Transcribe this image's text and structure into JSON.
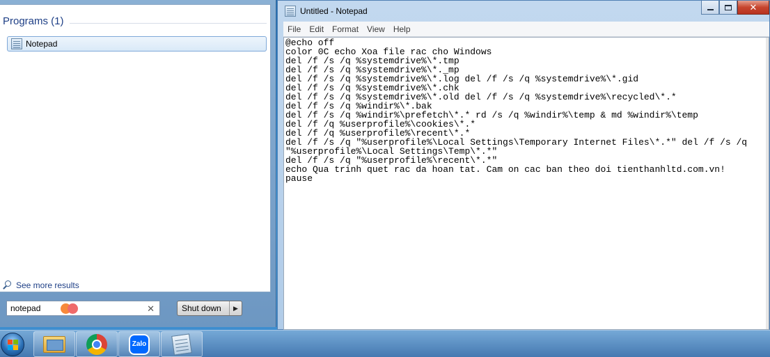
{
  "start_menu": {
    "programs_header": "Programs (1)",
    "programs": [
      {
        "label": "Notepad",
        "icon": "notepad-icon"
      }
    ],
    "see_more": "See more results",
    "search": {
      "value": "notepad"
    },
    "shutdown_label": "Shut down"
  },
  "notepad": {
    "title": "Untitled - Notepad",
    "menu": [
      "File",
      "Edit",
      "Format",
      "View",
      "Help"
    ],
    "content": "@echo off\ncolor 0C echo Xoa file rac cho Windows\ndel /f /s /q %systemdrive%\\*.tmp\ndel /f /s /q %systemdrive%\\*._mp\ndel /f /s /q %systemdrive%\\*.log del /f /s /q %systemdrive%\\*.gid\ndel /f /s /q %systemdrive%\\*.chk\ndel /f /s /q %systemdrive%\\*.old del /f /s /q %systemdrive%\\recycled\\*.*\ndel /f /s /q %windir%\\*.bak\ndel /f /s /q %windir%\\prefetch\\*.* rd /s /q %windir%\\temp & md %windir%\\temp\ndel /f /q %userprofile%\\cookies\\*.*\ndel /f /q %userprofile%\\recent\\*.*\ndel /f /s /q \"%userprofile%\\Local Settings\\Temporary Internet Files\\*.*\" del /f /s /q\n\"%userprofile%\\Local Settings\\Temp\\*.*\"\ndel /f /s /q \"%userprofile%\\recent\\*.*\"\necho Qua trinh quet rac da hoan tat. Cam on cac ban theo doi tienthanhltd.com.vn!\npause"
  },
  "taskbar": {
    "zalo_label": "Zalo"
  }
}
